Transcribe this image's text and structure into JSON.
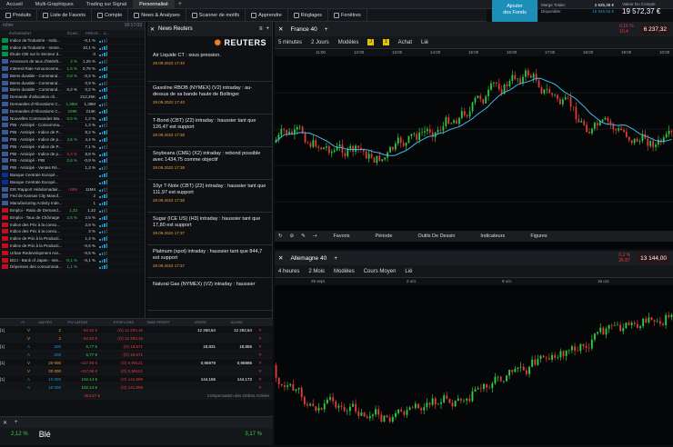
{
  "top_tabs": [
    "Accueil",
    "Multi-Graphiques",
    "Trading sur Signal",
    "Personnalisé"
  ],
  "top_plus": "+",
  "toolbar": [
    "Produits",
    "Liste de Favoris",
    "Compte",
    "News & Analyses",
    "Scanner de motifs",
    "Apprendre",
    "Réglages",
    "Fenêtres"
  ],
  "add_funds": [
    "Ajouter",
    "des Fonds"
  ],
  "account": {
    "margin_label": "Marge Totale:",
    "margin_value": "2 625,36 €",
    "avail_label": "Disponible:",
    "avail_value": "16 846,66 €"
  },
  "account_value": {
    "label": "Valeur Du Compte",
    "value": "19 572,37 €"
  },
  "left_panel": {
    "title": "rcher",
    "time": "18:17:03",
    "cols": [
      "ÉVÉNEMENT",
      "ÉCAR...",
      "PRÉCÉ...",
      "A..."
    ]
  },
  "calendar": [
    {
      "flag": "#009246",
      "name": "Indice de l'industrie - Indic...",
      "a": "",
      "b": "-0,1 %",
      "c": "#c8cdd2"
    },
    {
      "flag": "#009246",
      "name": "Indice de l'industrie - Vente...",
      "a": "",
      "b": "10,1 %",
      "c": "#c8cdd2"
    },
    {
      "flag": "#009246",
      "name": "Étude CBI sur le Secteur d...",
      "a": "",
      "b": "-3",
      "c": "#c8cdd2"
    },
    {
      "flag": "#3b5998",
      "name": "Annonces de taux d'intérêt...",
      "a": "2 %",
      "b": "1,25 %",
      "c": "#3ecf4a"
    },
    {
      "flag": "#3b5998",
      "name": "Interest Rate Announceme...",
      "a": "1,5 %",
      "b": "0,75 %",
      "c": "#3ecf4a"
    },
    {
      "flag": "#3b5998",
      "name": "Biens durable - Command...",
      "a": "0,8 %",
      "b": "-0,2 %",
      "c": "#3ecf4a"
    },
    {
      "flag": "#3b5998",
      "name": "Biens durable - Command...",
      "a": "",
      "b": "0,9 %",
      "c": "#c8cdd2"
    },
    {
      "flag": "#3b5998",
      "name": "Biens durable - Command...",
      "a": "0,2 %",
      "b": "0,2 %",
      "c": "#c8cdd2"
    },
    {
      "flag": "#3b5998",
      "name": "Demande d'allocation ch...",
      "a": "",
      "b": "212,25K",
      "c": "#c8cdd2"
    },
    {
      "flag": "#3b5998",
      "name": "Demandes d'Allocations C...",
      "a": "1,38M",
      "b": "1,38M",
      "c": "#3ecf4a"
    },
    {
      "flag": "#3b5998",
      "name": "Demandes d'Allocations C...",
      "a": "229K",
      "b": "214K",
      "c": "#3ecf4a"
    },
    {
      "flag": "#3b5998",
      "name": "Nouvelles Commandes Ma...",
      "a": "0,5 %",
      "b": "1,3 %",
      "c": "#3ecf4a"
    },
    {
      "flag": "#3b5998",
      "name": "PIB - Anticipé - Consomma...",
      "a": "",
      "b": "1,3 %",
      "c": "#c8cdd2"
    },
    {
      "flag": "#3b5998",
      "name": "PIB - Anticipé - Indice de P...",
      "a": "",
      "b": "8,2 %",
      "c": "#c8cdd2"
    },
    {
      "flag": "#3b5998",
      "name": "PIB - Anticipé - Indice de p...",
      "a": "4,5 %",
      "b": "4,4 %",
      "c": "#3ecf4a"
    },
    {
      "flag": "#3b5998",
      "name": "PIB - Anticipé - Indice de P...",
      "a": "",
      "b": "7,1 %",
      "c": "#c8cdd2"
    },
    {
      "flag": "#3b5998",
      "name": "PIB - Anticipé - Indice de p...",
      "a": "5,3 %",
      "b": "8,8 %",
      "c": "#e23b3b"
    },
    {
      "flag": "#3b5998",
      "name": "PIB - Anticipé - PIB",
      "a": "2,6 %",
      "b": "-0,9 %",
      "c": "#3ecf4a"
    },
    {
      "flag": "#3b5998",
      "name": "PIB - Anticipé - Ventes Ré...",
      "a": "",
      "b": "1,3 %",
      "c": "#c8cdd2"
    },
    {
      "flag": "#003399",
      "name": "Banque Centrale Europé...",
      "a": "",
      "b": "",
      "c": "#c8cdd2"
    },
    {
      "flag": "#003399",
      "name": "Banque Centrale Europé...",
      "a": "",
      "b": "",
      "c": "#c8cdd2"
    },
    {
      "flag": "#3b5998",
      "name": "EIE Rapport Hebdomadair...",
      "a": "-18M",
      "b": "11M4",
      "c": "#e23b3b"
    },
    {
      "flag": "#3b5998",
      "name": "Fed de Kansas City Manuf...",
      "a": "",
      "b": "2",
      "c": "#c8cdd2"
    },
    {
      "flag": "#3b5998",
      "name": "Manufacturing Activity Inde...",
      "a": "",
      "b": "1",
      "c": "#c8cdd2"
    },
    {
      "flag": "#c60b1e",
      "name": "Emploi - Ratio de Demand...",
      "a": "1,33",
      "b": "1,32",
      "c": "#3ecf4a"
    },
    {
      "flag": "#c60b1e",
      "name": "Emploi - Taux de Chômage",
      "a": "2,5 %",
      "b": "2,5 %",
      "c": "#3ecf4a"
    },
    {
      "flag": "#c60b1e",
      "name": "Indice des Prix à la conso...",
      "a": "",
      "b": "2,8 %",
      "c": "#c8cdd2"
    },
    {
      "flag": "#c60b1e",
      "name": "Indice des Prix à la conso...",
      "a": "",
      "b": "3 %",
      "c": "#c8cdd2"
    },
    {
      "flag": "#c60b1e",
      "name": "Indice de Prix à la Producti...",
      "a": "",
      "b": "1,4 %",
      "c": "#c8cdd2"
    },
    {
      "flag": "#c60b1e",
      "name": "Indice de Prix à la Producti...",
      "a": "",
      "b": "-0,6 %",
      "c": "#c8cdd2"
    },
    {
      "flag": "#c60b1e",
      "name": "Urban Redevelopment Aut...",
      "a": "",
      "b": "-0,5 %",
      "c": "#c8cdd2"
    },
    {
      "flag": "#c60b1e",
      "name": "BOJ - Bank of Japan - Inte...",
      "a": "-0,1 %",
      "b": "-0,1 %",
      "c": "#3ecf4a"
    },
    {
      "flag": "#c60b1e",
      "name": "Dépenses des consommat...",
      "a": "1,1 %",
      "b": "",
      "c": "#3ecf4a"
    }
  ],
  "news_panel": {
    "title": "News Reuters",
    "logo": "REUTERS"
  },
  "news": [
    {
      "title": "Air Liquide CT : sous pression.",
      "date": "28.09.2022 17:40"
    },
    {
      "title": "Gasoline RBOB (NYMEX) (V2) intraday : au-dessus de sa bande haute de Bollinger",
      "date": "28.09.2022 17:40"
    },
    {
      "title": "T-Bond (CBT) (Z2) intraday : haussier tant que 126,47 est support",
      "date": "28.09.2022 17:38"
    },
    {
      "title": "Soybeans (CME) (X2) intraday : rebond possible avec 1434,75 comme objectif",
      "date": "28.09.2022 17:38"
    },
    {
      "title": "10yr T-Note (CBT) (Z2) intraday : haussier tant que 111,97 est support",
      "date": "28.09.2022 17:38"
    },
    {
      "title": "Sugar (ICE US) (H3) intraday : haussier tant que 17,80 est support",
      "date": "28.09.2022 17:37"
    },
    {
      "title": "Platinum (spot) intraday : haussier tant que 844,7 est support",
      "date": "28.09.2022 17:37"
    },
    {
      "title": "Natural Gas (NYMEX) (V2) intraday : haussier",
      "date": ""
    }
  ],
  "orders": {
    "cols": [
      "/V",
      "UNITÉS",
      "P/V LATENT",
      "STOP LOSS",
      "TAKE PROFIT",
      "VENTE",
      "ACHAT"
    ],
    "rows": [
      {
        "n": "[1]",
        "s": "V",
        "u": "2",
        "pl": "-62,92 €",
        "sl": "(O) 12 293,16",
        "tp": "",
        "v": "12 260,64",
        "a": "12 262,64",
        "sc": "#f0a030",
        "pc": "#e23b3b"
      },
      {
        "n": "",
        "s": "V",
        "u": "2",
        "pl": "-62,92 €",
        "sl": "(O) 12 293,16",
        "tp": "",
        "v": "",
        "a": "",
        "sc": "#f0a030",
        "pc": "#e23b3b"
      },
      {
        "n": "[1]",
        "s": "A",
        "u": "200",
        "pl": "6,77 €",
        "sl": "(O) 18,571",
        "tp": "",
        "v": "18,831",
        "a": "18,856",
        "sc": "#1a9ad0",
        "pc": "#3ecf4a"
      },
      {
        "n": "",
        "s": "A",
        "u": "200",
        "pl": "6,77 €",
        "sl": "(O) 18,571",
        "tp": "",
        "v": "",
        "a": "",
        "sc": "#1a9ad0",
        "pc": "#3ecf4a"
      },
      {
        "n": "[1]",
        "s": "V",
        "u": "20 000",
        "pl": "-417,98 €",
        "sl": "(O) 0,99121",
        "tp": "",
        "v": "0,96979",
        "a": "0,96986",
        "sc": "#f0a030",
        "pc": "#e23b3b"
      },
      {
        "n": "",
        "s": "V",
        "u": "20 000",
        "pl": "-417,98 €",
        "sl": "(O) 0,99121",
        "tp": "",
        "v": "",
        "a": "",
        "sc": "#f0a030",
        "pc": "#e23b3b"
      },
      {
        "n": "[1]",
        "s": "A",
        "u": "10 000",
        "pl": "102,14 €",
        "sl": "(O) 141,699",
        "tp": "",
        "v": "144,165",
        "a": "144,172",
        "sc": "#1a9ad0",
        "pc": "#3ecf4a"
      },
      {
        "n": "",
        "s": "A",
        "u": "10 000",
        "pl": "102,14 €",
        "sl": "(O) 141,699",
        "tp": "",
        "v": "",
        "a": "",
        "sc": "#1a9ad0",
        "pc": "#3ecf4a"
      }
    ],
    "total": "463,57 €",
    "footer": "Compensation des Ordres Activée"
  },
  "bottom_left": {
    "a": "2,12 %",
    "b": "Blé",
    "c": "3,17 %",
    "d": "33,1 pts",
    "e": "27,24"
  },
  "chart1": {
    "title": "France 40",
    "interval": "5 minutes",
    "period": "2 Jours",
    "models": "Modèles",
    "buy": "Achat",
    "linked": "Lié",
    "change": "0,16 %",
    "change_pts": "10,4",
    "price": "6 237,32",
    "times": [
      "11:00",
      "12:00",
      "13:00",
      "14:00",
      "15:00",
      "16:00",
      "17:00",
      "18:00",
      "19:00",
      "10:00"
    ],
    "bottom": [
      "Favoris",
      "Période",
      "Outils De Dessin",
      "Indicateurs",
      "Figures"
    ]
  },
  "chart2": {
    "title": "Allemagne 40",
    "interval": "4 heures",
    "period": "2 Mois",
    "models": "Modèles",
    "avg": "Cours Moyen",
    "linked": "Lié",
    "change": "0,2 %",
    "change_pts": "26,87",
    "price": "13 144,00",
    "dates": [
      "25 sept.",
      "2 oct.",
      "9 oct.",
      "16 oct."
    ]
  }
}
